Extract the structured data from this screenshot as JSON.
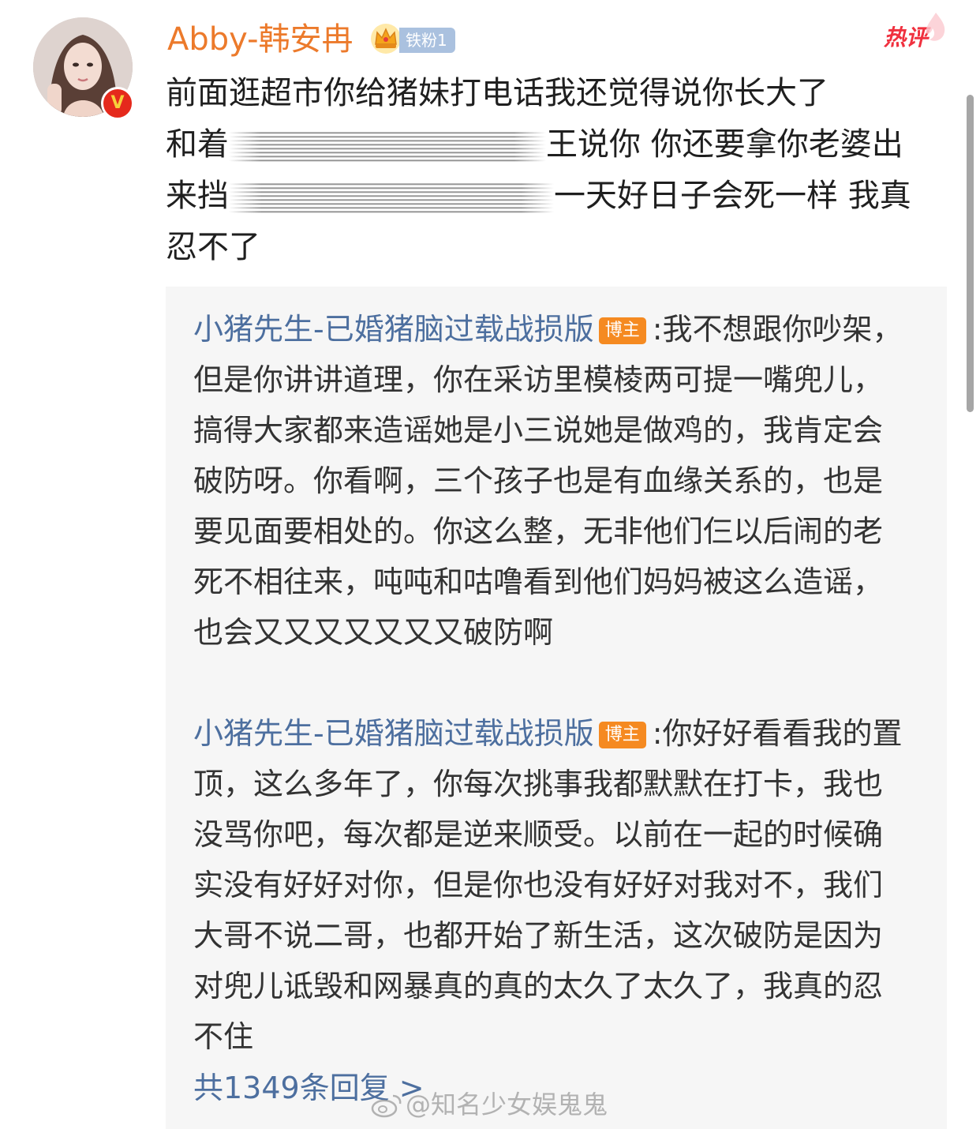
{
  "comment": {
    "username": "Abby-韩安冉",
    "fan_badge": "铁粉1",
    "hot_tag": "热评",
    "verified_mark": "V",
    "text_lines": [
      {
        "before": "前面逛超市你给猪妹打电话我还觉得说你长大了",
        "after": ""
      },
      {
        "before": "和着",
        "after": "王说你 你还要拿你老婆出"
      },
      {
        "before": "来挡",
        "after": "一天好日子会死一样 我真"
      },
      {
        "before": "忍不了",
        "after": ""
      }
    ]
  },
  "replies": [
    {
      "name": "小猪先生-已婚猪脑过载战损版",
      "badge": "博主",
      "text": ":我不想跟你吵架，但是你讲讲道理，你在采访里模棱两可提一嘴兜儿，搞得大家都来造谣她是小三说她是做鸡的，我肯定会破防呀。你看啊，三个孩子也是有血缘关系的，也是要见面要相处的。你这么整，无非他们仨以后闹的老死不相往来，吨吨和咕噜看到他们妈妈被这么造谣，也会又又又又又又又破防啊"
    },
    {
      "name": "小猪先生-已婚猪脑过载战损版",
      "badge": "博主",
      "text": ":你好好看看我的置顶，这么多年了，你每次挑事我都默默在打卡，我也没骂你吧，每次都是逆来顺受。以前在一起的时候确实没有好好对你，但是你也没有好好对我对不，我们大哥不说二哥，也都开始了新生活，这次破防是因为对兜儿诋毁和网暴真的真的太久了太久了，我真的忍不住"
    }
  ],
  "reply_count_label": "共1349条回复 >",
  "watermark": "@知名少女娱鬼鬼",
  "colors": {
    "username": "#ec7a2b",
    "reply_name": "#4d6f9f",
    "host_badge": "#f58a21",
    "hot_tag": "#f0313f",
    "fan_badge": "#aac1df",
    "reply_bg": "#f6f6f6"
  },
  "icons": [
    "avatar",
    "verified-v-icon",
    "crown-icon",
    "hot-flame-icon",
    "weibo-logo-icon"
  ]
}
